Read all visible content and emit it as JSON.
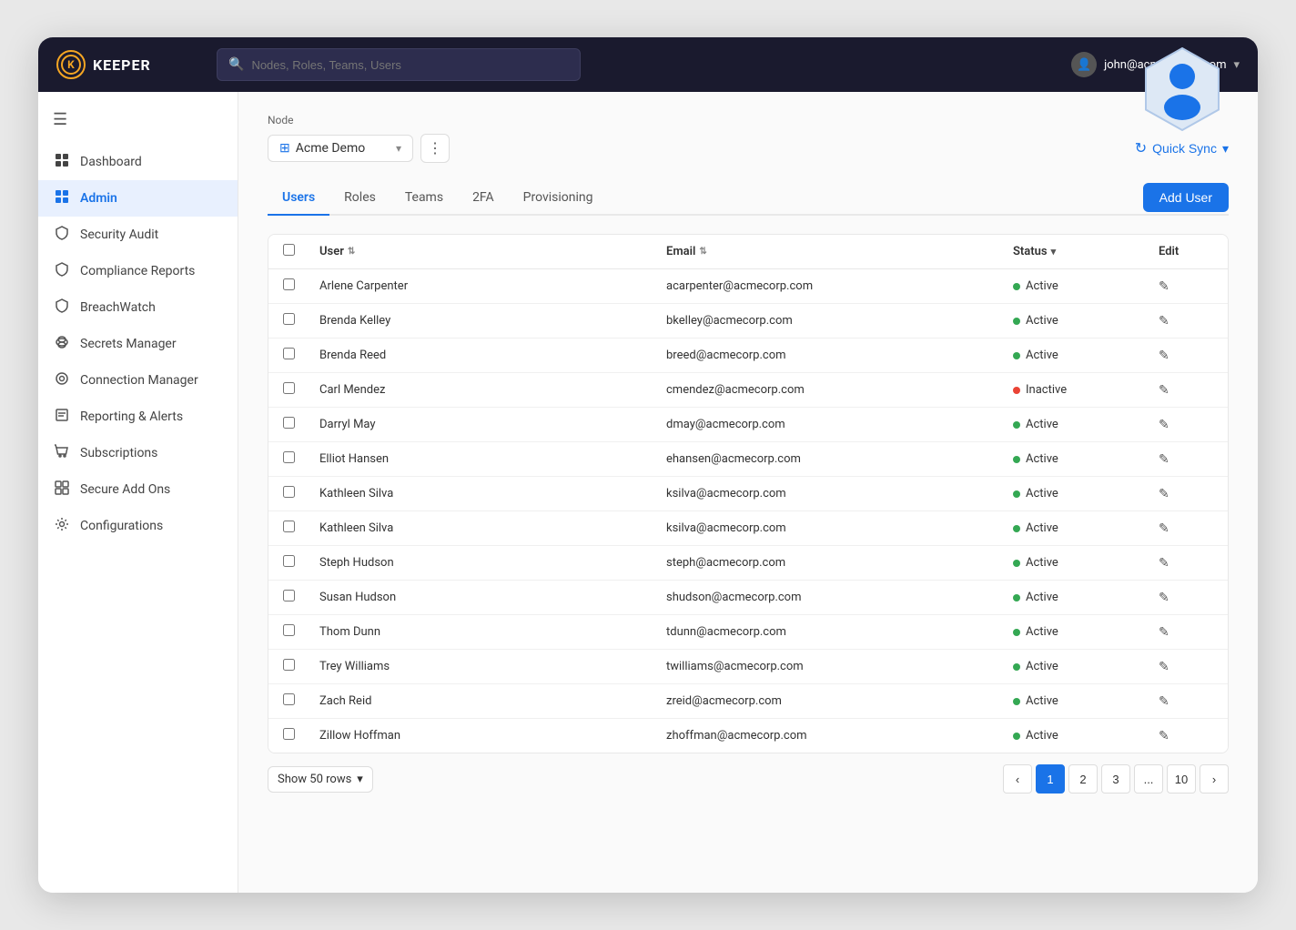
{
  "app": {
    "title": "KEEPER",
    "logo_letter": "K"
  },
  "topnav": {
    "search_placeholder": "Nodes, Roles, Teams, Users",
    "user_email": "john@acme-demo.com"
  },
  "sidebar": {
    "hamburger_label": "☰",
    "items": [
      {
        "id": "dashboard",
        "label": "Dashboard",
        "icon": "▦",
        "active": false
      },
      {
        "id": "admin",
        "label": "Admin",
        "icon": "⊞",
        "active": true
      },
      {
        "id": "security-audit",
        "label": "Security Audit",
        "icon": "🛡",
        "active": false
      },
      {
        "id": "compliance-reports",
        "label": "Compliance Reports",
        "icon": "🛡",
        "active": false
      },
      {
        "id": "breachwatch",
        "label": "BreachWatch",
        "icon": "🛡",
        "active": false
      },
      {
        "id": "secrets-manager",
        "label": "Secrets Manager",
        "icon": "⊛",
        "active": false
      },
      {
        "id": "connection-manager",
        "label": "Connection Manager",
        "icon": "⚙",
        "active": false
      },
      {
        "id": "reporting-alerts",
        "label": "Reporting & Alerts",
        "icon": "☰",
        "active": false
      },
      {
        "id": "subscriptions",
        "label": "Subscriptions",
        "icon": "🛒",
        "active": false
      },
      {
        "id": "secure-add-ons",
        "label": "Secure Add Ons",
        "icon": "⊞",
        "active": false
      },
      {
        "id": "configurations",
        "label": "Configurations",
        "icon": "⚙",
        "active": false
      }
    ]
  },
  "node": {
    "label": "Node",
    "selected": "Acme Demo",
    "quick_sync": "Quick Sync"
  },
  "tabs": [
    {
      "id": "users",
      "label": "Users",
      "active": true
    },
    {
      "id": "roles",
      "label": "Roles",
      "active": false
    },
    {
      "id": "teams",
      "label": "Teams",
      "active": false
    },
    {
      "id": "2fa",
      "label": "2FA",
      "active": false
    },
    {
      "id": "provisioning",
      "label": "Provisioning",
      "active": false
    }
  ],
  "add_user_button": "Add User",
  "table": {
    "columns": [
      {
        "id": "select",
        "label": ""
      },
      {
        "id": "user",
        "label": "User",
        "sortable": true
      },
      {
        "id": "email",
        "label": "Email",
        "sortable": true
      },
      {
        "id": "status",
        "label": "Status",
        "filterable": true
      },
      {
        "id": "edit",
        "label": "Edit"
      }
    ],
    "rows": [
      {
        "name": "Arlene Carpenter",
        "email": "acarpenter@acmecorp.com",
        "status": "Active"
      },
      {
        "name": "Brenda Kelley",
        "email": "bkelley@acmecorp.com",
        "status": "Active"
      },
      {
        "name": "Brenda Reed",
        "email": "breed@acmecorp.com",
        "status": "Active"
      },
      {
        "name": "Carl Mendez",
        "email": "cmendez@acmecorp.com",
        "status": "Inactive"
      },
      {
        "name": "Darryl May",
        "email": "dmay@acmecorp.com",
        "status": "Active"
      },
      {
        "name": "Elliot Hansen",
        "email": "ehansen@acmecorp.com",
        "status": "Active"
      },
      {
        "name": "Kathleen Silva",
        "email": "ksilva@acmecorp.com",
        "status": "Active"
      },
      {
        "name": "Kathleen Silva",
        "email": "ksilva@acmecorp.com",
        "status": "Active"
      },
      {
        "name": "Steph Hudson",
        "email": "steph@acmecorp.com",
        "status": "Active"
      },
      {
        "name": "Susan Hudson",
        "email": "shudson@acmecorp.com",
        "status": "Active"
      },
      {
        "name": "Thom Dunn",
        "email": "tdunn@acmecorp.com",
        "status": "Active"
      },
      {
        "name": "Trey Williams",
        "email": "twilliams@acmecorp.com",
        "status": "Active"
      },
      {
        "name": "Zach Reid",
        "email": "zreid@acmecorp.com",
        "status": "Active"
      },
      {
        "name": "Zillow Hoffman",
        "email": "zhoffman@acmecorp.com",
        "status": "Active"
      }
    ]
  },
  "pagination": {
    "rows_selector_label": "Show 50 rows",
    "pages": [
      "1",
      "2",
      "3",
      "...",
      "10"
    ],
    "current_page": "1"
  }
}
